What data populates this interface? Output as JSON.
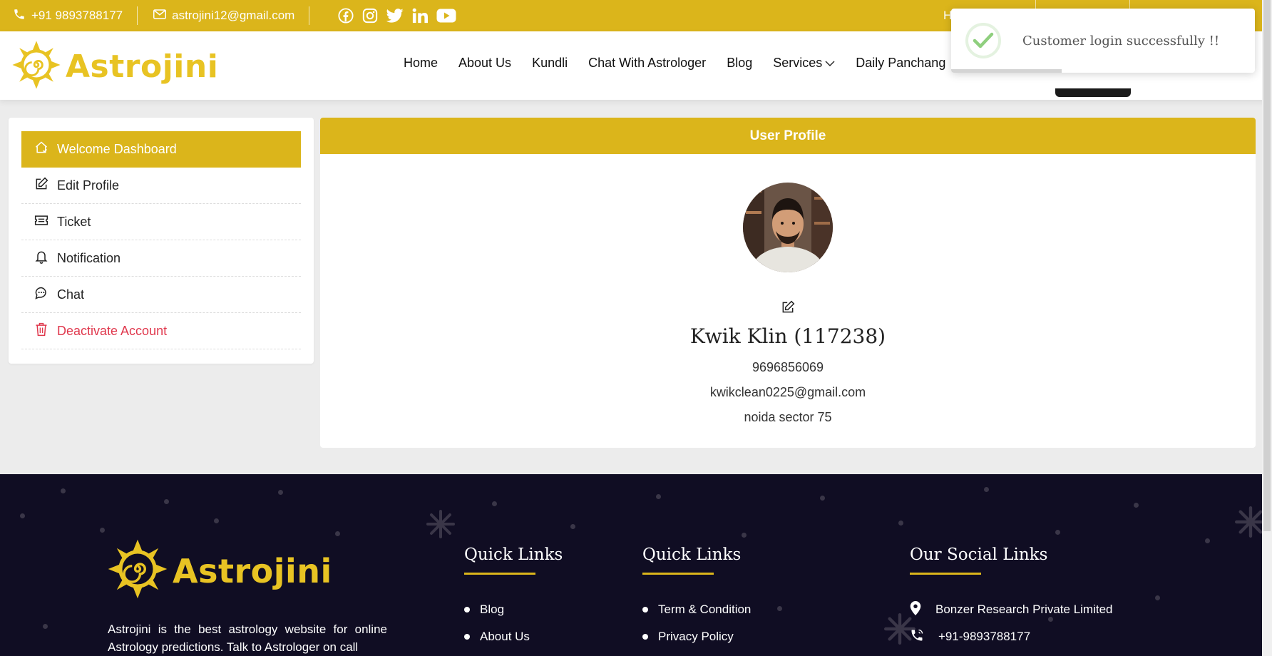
{
  "topbar": {
    "phone": "+91 9893788177",
    "email": "astrojini12@gmail.com",
    "partial_link": "H",
    "socials": [
      "facebook-icon",
      "instagram-icon",
      "twitter-icon",
      "linkedin-icon",
      "youtube-icon"
    ]
  },
  "brand": {
    "name": "Astrojini",
    "color": "#e8c323",
    "accent": "#dbb51b"
  },
  "nav": {
    "items": [
      "Home",
      "About Us",
      "Kundli",
      "Chat With Astrologer",
      "Blog",
      "Services",
      "Daily Panchang"
    ]
  },
  "toast": {
    "message": "Customer login successfully !!"
  },
  "sidebar": {
    "items": [
      {
        "label": "Welcome Dashboard",
        "icon": "home-icon",
        "active": true
      },
      {
        "label": "Edit Profile",
        "icon": "edit-icon"
      },
      {
        "label": "Ticket",
        "icon": "ticket-icon"
      },
      {
        "label": "Notification",
        "icon": "bell-icon"
      },
      {
        "label": "Chat",
        "icon": "chat-icon"
      },
      {
        "label": "Deactivate Account",
        "icon": "trash-icon",
        "danger": true
      }
    ]
  },
  "profile": {
    "header": "User Profile",
    "name": "Kwik Klin (117238)",
    "phone": "9696856069",
    "email": "kwikclean0225@gmail.com",
    "address": "noida sector 75"
  },
  "footer": {
    "description": "Astrojini is the best astrology website for online Astrology predictions. Talk to Astrologer on call",
    "col1": {
      "title": "Quick Links",
      "links": [
        "Blog",
        "About Us"
      ]
    },
    "col2": {
      "title": "Quick Links",
      "links": [
        "Term & Condition",
        "Privacy Policy"
      ]
    },
    "col3": {
      "title": "Our Social Links",
      "company": "Bonzer Research Private Limited",
      "phone": "+91-9893788177"
    }
  }
}
